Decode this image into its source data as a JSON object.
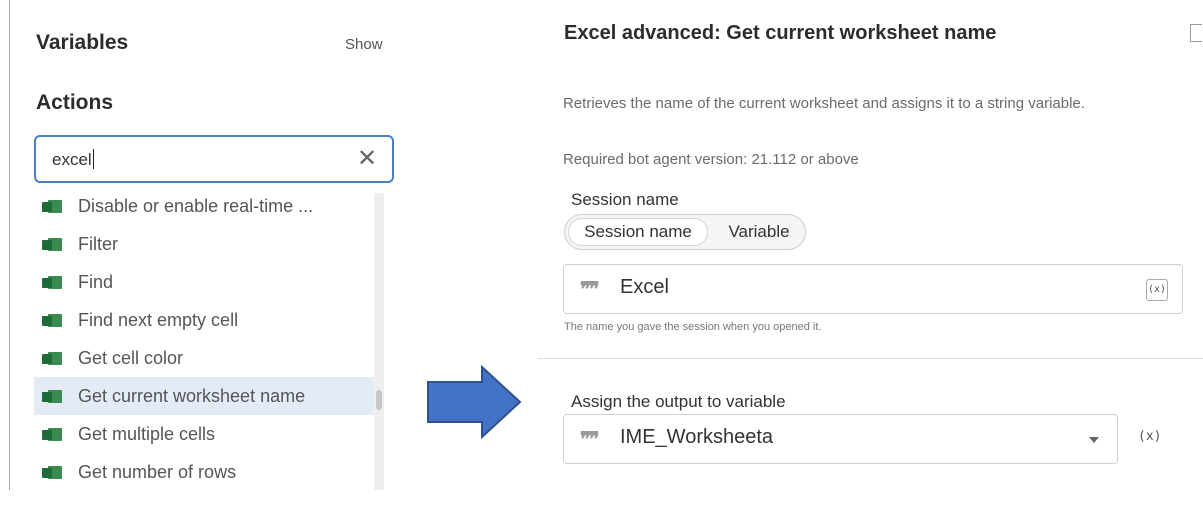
{
  "left_panel": {
    "variables_heading": "Variables",
    "show_link": "Show",
    "actions_heading": "Actions",
    "search": {
      "value": "excel",
      "clear_icon": "close-icon"
    },
    "items": [
      {
        "label": "Disable or enable real-time ...",
        "icon": "excel-icon",
        "selected": false
      },
      {
        "label": "Filter",
        "icon": "excel-icon",
        "selected": false
      },
      {
        "label": "Find",
        "icon": "excel-icon",
        "selected": false
      },
      {
        "label": "Find next empty cell",
        "icon": "excel-icon",
        "selected": false
      },
      {
        "label": "Get cell color",
        "icon": "excel-icon",
        "selected": false
      },
      {
        "label": "Get current worksheet name",
        "icon": "excel-icon",
        "selected": true
      },
      {
        "label": "Get multiple cells",
        "icon": "excel-icon",
        "selected": false
      },
      {
        "label": "Get number of rows",
        "icon": "excel-icon",
        "selected": false
      }
    ]
  },
  "arrow": {
    "color": "#4472c4",
    "border_color": "#2f528f"
  },
  "right_panel": {
    "title": "Excel advanced: Get current worksheet name",
    "description": "Retrieves the name of the current worksheet and assigns it to a string variable.",
    "required_version": "Required bot agent version: 21.112 or above",
    "session": {
      "label": "Session name",
      "toggle_options": [
        "Session name",
        "Variable"
      ],
      "selected_option": "Session name",
      "value": "Excel",
      "var_button": "(x)",
      "hint": "The name you gave the session when you opened it."
    },
    "output": {
      "label": "Assign the output to variable",
      "value": "IME_Worksheeta",
      "var_button": "(x)"
    }
  },
  "colors": {
    "accent": "#4a7fc1",
    "selected_row": "#e3ecf6",
    "excel_green": "#1d6b37"
  }
}
